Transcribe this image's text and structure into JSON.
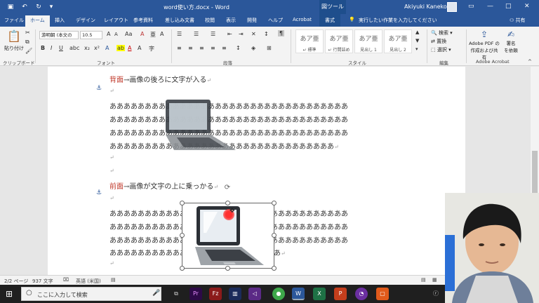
{
  "window": {
    "title": "word使い方.docx - Word",
    "context_tab_title": "図ツール",
    "user_name": "Akiyuki Kaneko",
    "share_label": "共有",
    "tell_me": "実行したい作業を入力してください"
  },
  "tabs": [
    "ファイル",
    "ホーム",
    "挿入",
    "デザイン",
    "レイアウト",
    "参考資料",
    "差し込み文書",
    "校閲",
    "表示",
    "開発",
    "ヘルプ",
    "Acrobat",
    "書式"
  ],
  "ribbon": {
    "clipboard": {
      "paste": "貼り付け",
      "label": "クリップボード"
    },
    "font": {
      "name": "游明朝 (本文の",
      "size": "10.5",
      "label": "フォント"
    },
    "paragraph": {
      "label": "段落"
    },
    "styles": {
      "label": "スタイル",
      "items": [
        {
          "sample": "あア亜",
          "name": "↵ 標準"
        },
        {
          "sample": "あア亜",
          "name": "↵ 行間詰め"
        },
        {
          "sample": "あア亜",
          "name": "見出し 1"
        },
        {
          "sample": "あア亜",
          "name": "見出し 2"
        }
      ]
    },
    "editing": {
      "find": "検索",
      "replace": "置換",
      "select": "選択",
      "label": "編集"
    },
    "acrobat": {
      "create1": "Adobe PDF の",
      "create2": "作成および共有",
      "sign1": "署名",
      "sign2": "を依頼",
      "label": "Adobe Acrobat"
    }
  },
  "document": {
    "heading1": {
      "red": "背面",
      "rest": "→画像の後ろに文字が入る"
    },
    "heading2": {
      "red": "前面",
      "rest": "→画像が文字の上に乗っかる"
    },
    "para_line": "ああああああああああああああああああああああああああああああああああ",
    "para_last1": "ああああああああああああああああああああああああああああああああ",
    "para_last2": "ああああああああああああああああああああ",
    "para_last2_end": "あ"
  },
  "status": {
    "page": "2/2 ページ",
    "words": "937 文字",
    "lang": "英語 (米国)"
  },
  "taskbar": {
    "search_placeholder": "ここに入力して検索"
  }
}
